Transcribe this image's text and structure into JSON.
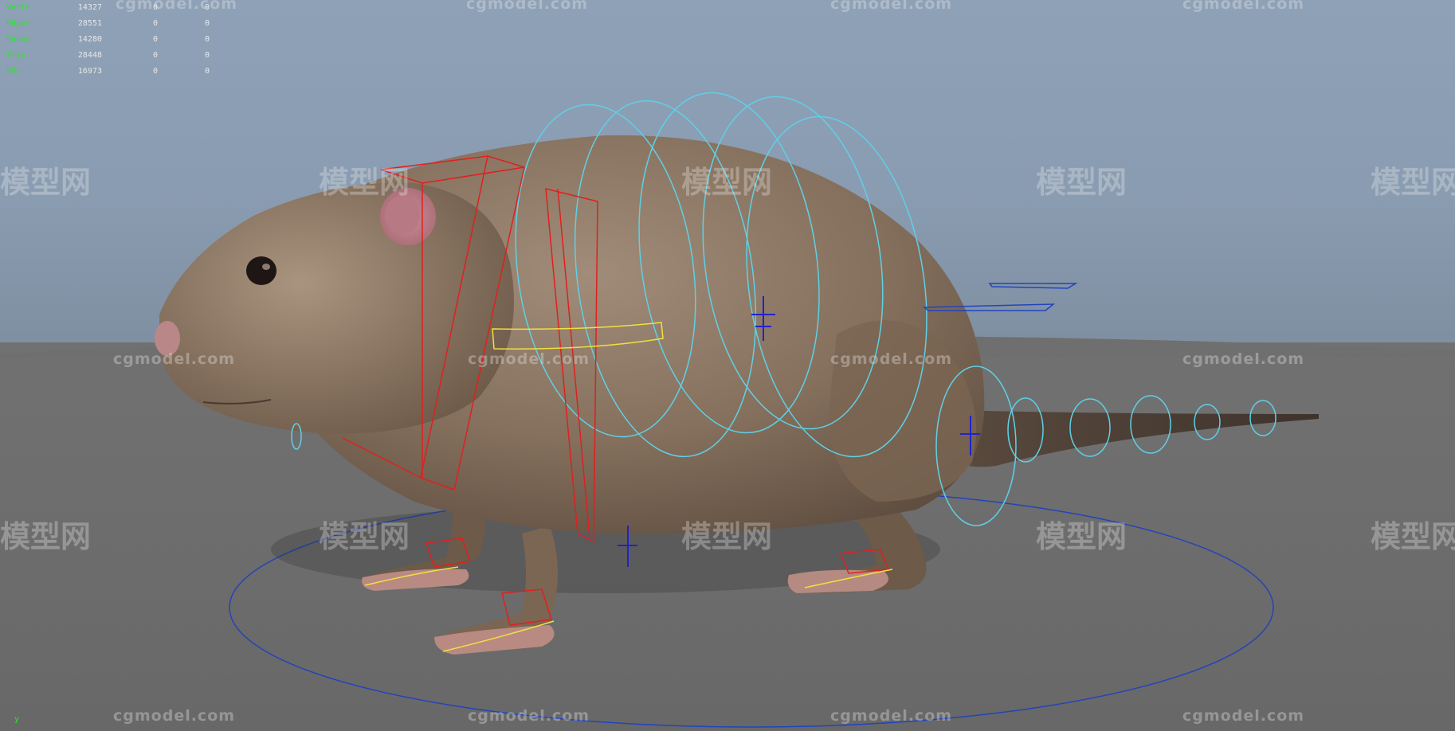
{
  "hud": {
    "rows": [
      {
        "label": "Verts",
        "total": "14327",
        "selected": "0",
        "component": "0"
      },
      {
        "label": "Edges",
        "total": "28551",
        "selected": "0",
        "component": "0"
      },
      {
        "label": "Faces",
        "total": "14280",
        "selected": "0",
        "component": "0"
      },
      {
        "label": "Tris",
        "total": "28448",
        "selected": "0",
        "component": "0"
      },
      {
        "label": "UVs",
        "total": "16973",
        "selected": "0",
        "component": "0"
      }
    ]
  },
  "watermarks": {
    "url": "cgmodel.com",
    "cn": "模型网"
  },
  "axis": {
    "y_label": "y"
  },
  "colors": {
    "sky_top": "#8ea1b7",
    "ground": "#6e6e6e",
    "hud_label": "#2ee32e",
    "rig_ring": "#5fd0e6",
    "rig_box": "#e02020",
    "rig_foot": "#f0e040",
    "rig_master": "#2244bb",
    "rig_locator": "#2222cc",
    "fur": "#8a7663"
  },
  "icons": [
    "axis-gizmo-icon",
    "locator-icon"
  ]
}
